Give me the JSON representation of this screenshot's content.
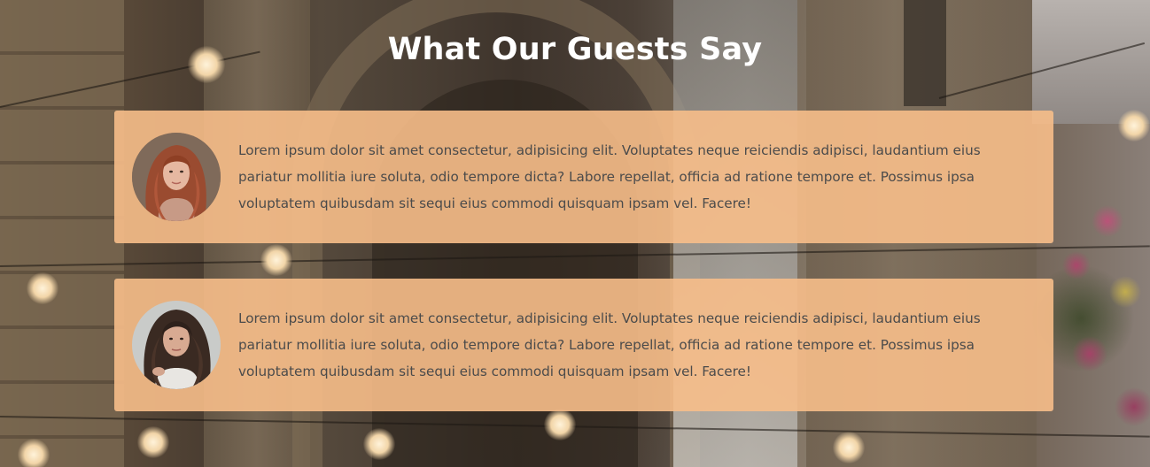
{
  "section": {
    "title": "What Our Guests Say"
  },
  "testimonials": [
    {
      "avatar_icon": "woman-red-hair-portrait",
      "text": "Lorem ipsum dolor sit amet consectetur, adipisicing elit. Voluptates neque reiciendis adipisci, laudantium eius pariatur mollitia iure soluta, odio tempore dicta? Labore repellat, officia ad ratione tempore et. Possimus ipsa voluptatem quibusdam sit sequi eius commodi quisquam ipsam vel. Facere!"
    },
    {
      "avatar_icon": "woman-dark-hair-portrait",
      "text": "Lorem ipsum dolor sit amet consectetur, adipisicing elit. Voluptates neque reiciendis adipisci, laudantium eius pariatur mollitia iure soluta, odio tempore dicta? Labore repellat, officia ad ratione tempore et. Possimus ipsa voluptatem quibusdam sit sequi eius commodi quisquam ipsam vel. Facere!"
    }
  ],
  "colors": {
    "card_background": "#f7be89",
    "title_text": "#ffffff",
    "body_text": "#4b4b4b"
  }
}
